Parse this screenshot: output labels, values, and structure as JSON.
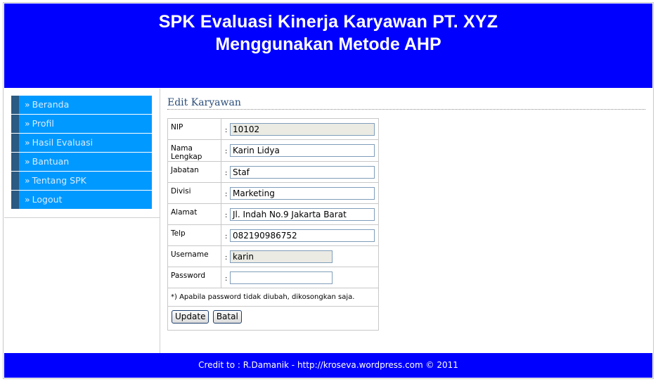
{
  "header": {
    "line1": "SPK Evaluasi Kinerja Karyawan PT. XYZ",
    "line2": "Menggunakan Metode AHP"
  },
  "sidebar": {
    "items": [
      {
        "label": "Beranda"
      },
      {
        "label": "Profil"
      },
      {
        "label": "Hasil Evaluasi"
      },
      {
        "label": "Bantuan"
      },
      {
        "label": "Tentang SPK"
      },
      {
        "label": "Logout"
      }
    ],
    "arrow": "»"
  },
  "main": {
    "title": "Edit Karyawan",
    "separator": ":",
    "fields": {
      "nip": {
        "label": "NIP",
        "value": "10102"
      },
      "nama": {
        "label": "Nama Lengkap",
        "value": "Karin Lidya"
      },
      "jabatan": {
        "label": "Jabatan",
        "value": "Staf"
      },
      "divisi": {
        "label": "Divisi",
        "value": "Marketing"
      },
      "alamat": {
        "label": "Alamat",
        "value": "Jl. Indah No.9 Jakarta Barat"
      },
      "telp": {
        "label": "Telp",
        "value": "082190986752"
      },
      "username": {
        "label": "Username",
        "value": "karin"
      },
      "password": {
        "label": "Password",
        "value": ""
      }
    },
    "note": "*) Apabila password tidak diubah, dikosongkan saja.",
    "update_label": "Update",
    "batal_label": "Batal"
  },
  "footer": {
    "credit": "Credit to : R.Damanik - http://kroseva.wordpress.com © 2011"
  },
  "colors": {
    "header_bg": "#0000ff",
    "menu_bg": "#0099ff",
    "menu_accent": "#2b5a82",
    "readonly_bg": "#ebebe4"
  }
}
